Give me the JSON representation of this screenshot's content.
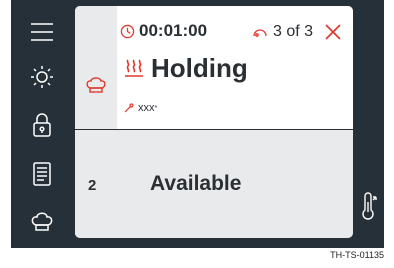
{
  "header": {
    "timer": "00:01:00",
    "count": "3 of 3"
  },
  "status": {
    "label": "Holding",
    "probe": "xxx",
    "probe_mark": "*"
  },
  "slot": {
    "number": "2",
    "state": "Available"
  },
  "figure_id": "TH-TS-01135",
  "colors": {
    "screen_bg": "#253038",
    "accent": "#e03a2f",
    "text": "#2a2f33",
    "panel_bg": "#e9eaec"
  },
  "icons": [
    "menu-icon",
    "brightness-icon",
    "lock-icon",
    "recipe-book-icon",
    "chef-hat-icon",
    "clock-icon",
    "probe-link-icon",
    "close-icon",
    "heat-icon",
    "chef-hat-icon",
    "probe-icon",
    "thermometer-icon"
  ]
}
